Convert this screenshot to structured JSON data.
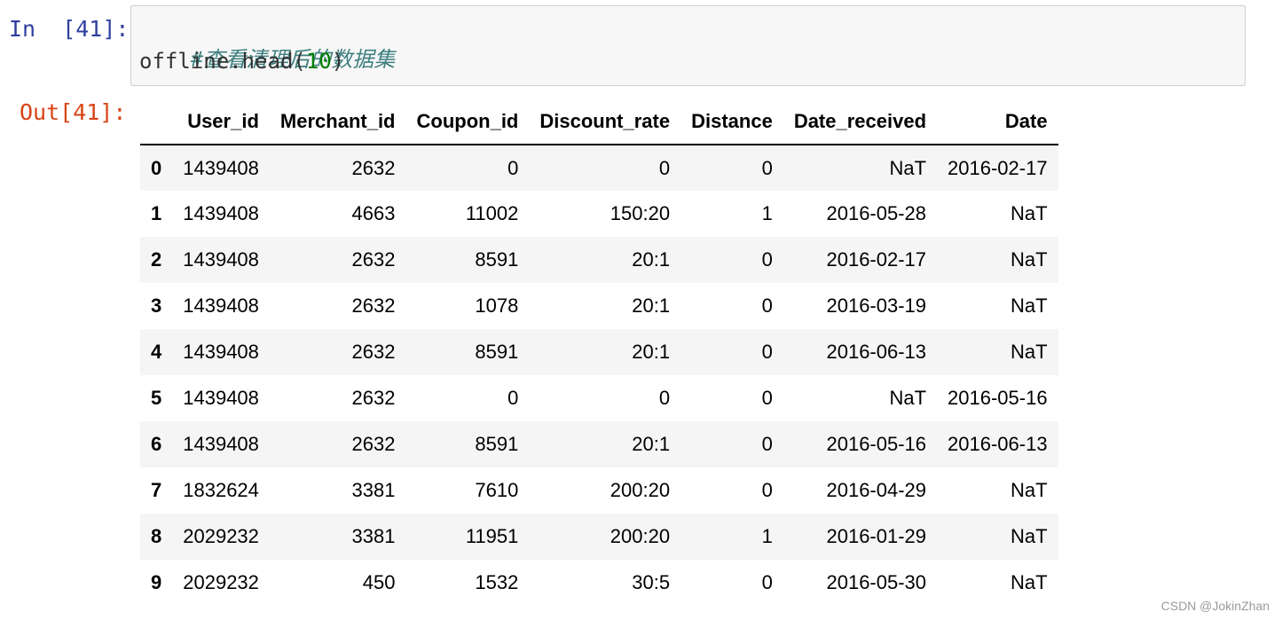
{
  "input_prompt": "In  [41]:",
  "output_prompt": "Out[41]:",
  "code": {
    "comment": "#查看清理后的数据集",
    "call_prefix": "offline.head(",
    "call_arg": "10",
    "call_suffix": ")"
  },
  "table": {
    "index_header": "",
    "columns": [
      "User_id",
      "Merchant_id",
      "Coupon_id",
      "Discount_rate",
      "Distance",
      "Date_received",
      "Date"
    ],
    "rows": [
      {
        "index": "0",
        "cells": [
          "1439408",
          "2632",
          "0",
          "0",
          "0",
          "NaT",
          "2016-02-17"
        ]
      },
      {
        "index": "1",
        "cells": [
          "1439408",
          "4663",
          "11002",
          "150:20",
          "1",
          "2016-05-28",
          "NaT"
        ]
      },
      {
        "index": "2",
        "cells": [
          "1439408",
          "2632",
          "8591",
          "20:1",
          "0",
          "2016-02-17",
          "NaT"
        ]
      },
      {
        "index": "3",
        "cells": [
          "1439408",
          "2632",
          "1078",
          "20:1",
          "0",
          "2016-03-19",
          "NaT"
        ]
      },
      {
        "index": "4",
        "cells": [
          "1439408",
          "2632",
          "8591",
          "20:1",
          "0",
          "2016-06-13",
          "NaT"
        ]
      },
      {
        "index": "5",
        "cells": [
          "1439408",
          "2632",
          "0",
          "0",
          "0",
          "NaT",
          "2016-05-16"
        ]
      },
      {
        "index": "6",
        "cells": [
          "1439408",
          "2632",
          "8591",
          "20:1",
          "0",
          "2016-05-16",
          "2016-06-13"
        ]
      },
      {
        "index": "7",
        "cells": [
          "1832624",
          "3381",
          "7610",
          "200:20",
          "0",
          "2016-04-29",
          "NaT"
        ]
      },
      {
        "index": "8",
        "cells": [
          "2029232",
          "3381",
          "11951",
          "200:20",
          "1",
          "2016-01-29",
          "NaT"
        ]
      },
      {
        "index": "9",
        "cells": [
          "2029232",
          "450",
          "1532",
          "30:5",
          "0",
          "2016-05-30",
          "NaT"
        ]
      }
    ]
  },
  "watermark": "CSDN @JokinZhan",
  "colors": {
    "input_prompt": "#303f9f",
    "output_prompt": "#d84315",
    "comment": "#408080",
    "number": "#008000",
    "striped_row": "#f5f5f5"
  }
}
